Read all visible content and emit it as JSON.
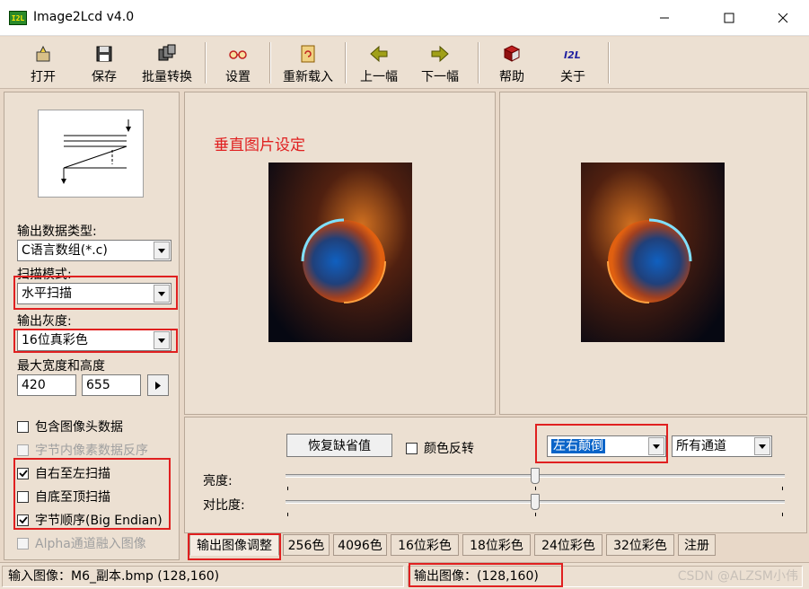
{
  "window": {
    "title": "Image2Lcd v4.0",
    "icon_text": "I2L"
  },
  "toolbar": {
    "items": [
      {
        "label": "打开",
        "icon": "open-icon"
      },
      {
        "label": "保存",
        "icon": "save-icon"
      },
      {
        "label": "批量转换",
        "icon": "batch-convert-icon"
      },
      {
        "label": "设置",
        "icon": "settings-glasses-icon"
      },
      {
        "label": "重新载入",
        "icon": "reload-icon"
      },
      {
        "label": "上一幅",
        "icon": "arrow-left-icon"
      },
      {
        "label": "下一幅",
        "icon": "arrow-right-icon"
      },
      {
        "label": "帮助",
        "icon": "help-book-icon"
      },
      {
        "label": "关于",
        "icon": "about-i2l-icon"
      }
    ]
  },
  "left": {
    "output_type_label": "输出数据类型:",
    "output_type_value": "C语言数组(*.c)",
    "scan_mode_label": "扫描模式:",
    "scan_mode_value": "水平扫描",
    "gray_label": "输出灰度:",
    "gray_value": "16位真彩色",
    "size_label": "最大宽度和高度",
    "max_width": "420",
    "max_height": "655",
    "checks": [
      {
        "label": "包含图像头数据",
        "checked": false,
        "enabled": true
      },
      {
        "label": "字节内像素数据反序",
        "checked": false,
        "enabled": false
      },
      {
        "label": "自右至左扫描",
        "checked": true,
        "enabled": true
      },
      {
        "label": "自底至顶扫描",
        "checked": false,
        "enabled": true
      },
      {
        "label": "字节顺序(Big Endian)",
        "checked": true,
        "enabled": true
      },
      {
        "label": "Alpha通道融入图像",
        "checked": false,
        "enabled": false
      }
    ]
  },
  "preview": {
    "caption": "垂直图片设定"
  },
  "controls": {
    "reset_label": "恢复缺省值",
    "invert_label": "颜色反转",
    "invert_checked": false,
    "flip_value": "左右颠倒",
    "channel_value": "所有通道",
    "brightness_label": "亮度:",
    "contrast_label": "对比度:",
    "brightness": 0.5,
    "contrast": 0.5
  },
  "tabs": [
    "输出图像调整",
    "256色",
    "4096色",
    "16位彩色",
    "18位彩色",
    "24位彩色",
    "32位彩色",
    "注册"
  ],
  "status": {
    "input": "输入图像：M6_副本.bmp (128,160)",
    "output": "输出图像：(128,160)",
    "watermark": "CSDN @ALZSM小伟"
  },
  "colors": {
    "highlight_box": "#e02020",
    "panel_bg": "#ece0d2",
    "selection": "#0a64c8"
  }
}
